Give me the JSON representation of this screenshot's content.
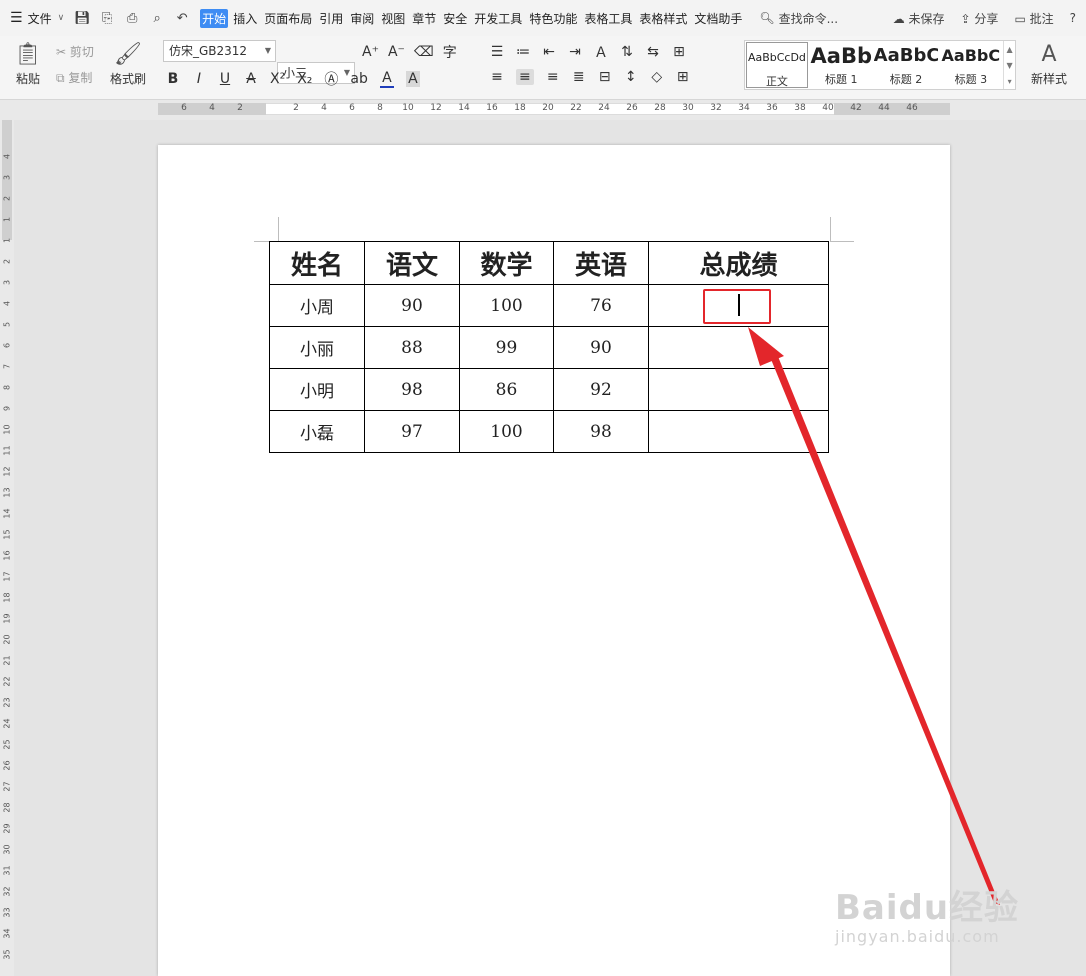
{
  "menubar": {
    "file": "文件",
    "tabs": [
      "开始",
      "插入",
      "页面布局",
      "引用",
      "审阅",
      "视图",
      "章节",
      "安全",
      "开发工具",
      "特色功能",
      "表格工具",
      "表格样式",
      "文档助手"
    ],
    "active_tab": "开始",
    "search": "查找命令...",
    "unsaved": "未保存",
    "share": "分享",
    "comment": "批注",
    "help": "?"
  },
  "ribbon": {
    "paste": "粘贴",
    "cut": "剪切",
    "copy": "复制",
    "format_painter": "格式刷",
    "font_name": "仿宋_GB2312",
    "font_size": "小三",
    "styles": [
      {
        "preview": "AaBbCcDd",
        "name": "正文"
      },
      {
        "preview": "AaBb",
        "name": "标题 1"
      },
      {
        "preview": "AaBbC",
        "name": "标题 2"
      },
      {
        "preview": "AaBbC",
        "name": "标题 3"
      }
    ],
    "new_style": "新样式"
  },
  "ruler": {
    "h_ticks": [
      "6",
      "4",
      "2",
      "2",
      "4",
      "6",
      "8",
      "10",
      "12",
      "14",
      "16",
      "18",
      "20",
      "22",
      "24",
      "26",
      "28",
      "30",
      "32",
      "34",
      "36",
      "38",
      "40",
      "42",
      "44",
      "46"
    ],
    "v_ticks": [
      "4",
      "3",
      "2",
      "1",
      "1",
      "2",
      "3",
      "4",
      "5",
      "6",
      "7",
      "8",
      "9",
      "10",
      "11",
      "12",
      "13",
      "14",
      "15",
      "16",
      "17",
      "18",
      "19",
      "20",
      "21",
      "22",
      "23",
      "24",
      "25",
      "26",
      "27",
      "28",
      "29",
      "30",
      "31",
      "32",
      "33",
      "34",
      "35"
    ]
  },
  "table": {
    "headers": [
      "姓名",
      "语文",
      "数学",
      "英语",
      "总成绩"
    ],
    "rows": [
      [
        "小周",
        "90",
        "100",
        "76",
        ""
      ],
      [
        "小丽",
        "88",
        "99",
        "90",
        ""
      ],
      [
        "小明",
        "98",
        "86",
        "92",
        ""
      ],
      [
        "小磊",
        "97",
        "100",
        "98",
        ""
      ]
    ]
  },
  "colors": {
    "accent": "#3e8cf3",
    "highlight": "#e3262b"
  },
  "watermark": {
    "line1": "Baidu经验",
    "line2": "jingyan.baidu.com"
  }
}
